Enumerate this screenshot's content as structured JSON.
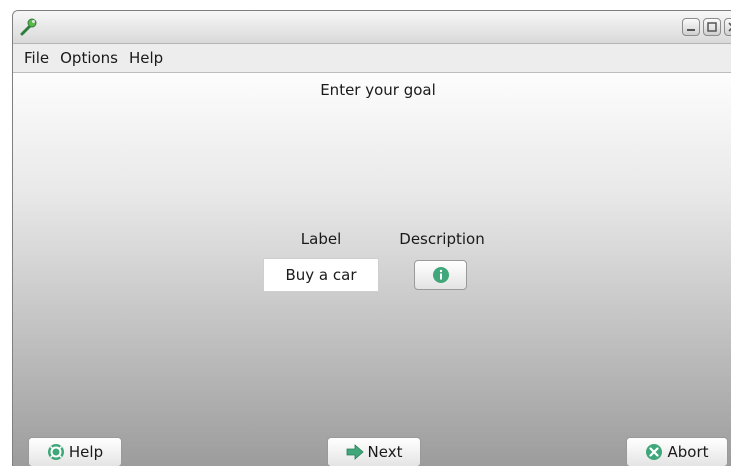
{
  "window": {
    "app_icon": "wrench-icon",
    "controls": [
      "minimize-icon",
      "maximize-icon",
      "close-icon"
    ]
  },
  "menu": {
    "items": [
      "File",
      "Options",
      "Help"
    ]
  },
  "wizard": {
    "heading": "Enter your goal",
    "label_header": "Label",
    "description_header": "Description",
    "goal_label_value": "Buy a car",
    "description_icon": "info-icon"
  },
  "buttons": {
    "help": "Help",
    "next": "Next",
    "abort": "Abort"
  },
  "colors": {
    "accent_green": "#3fa77a"
  }
}
